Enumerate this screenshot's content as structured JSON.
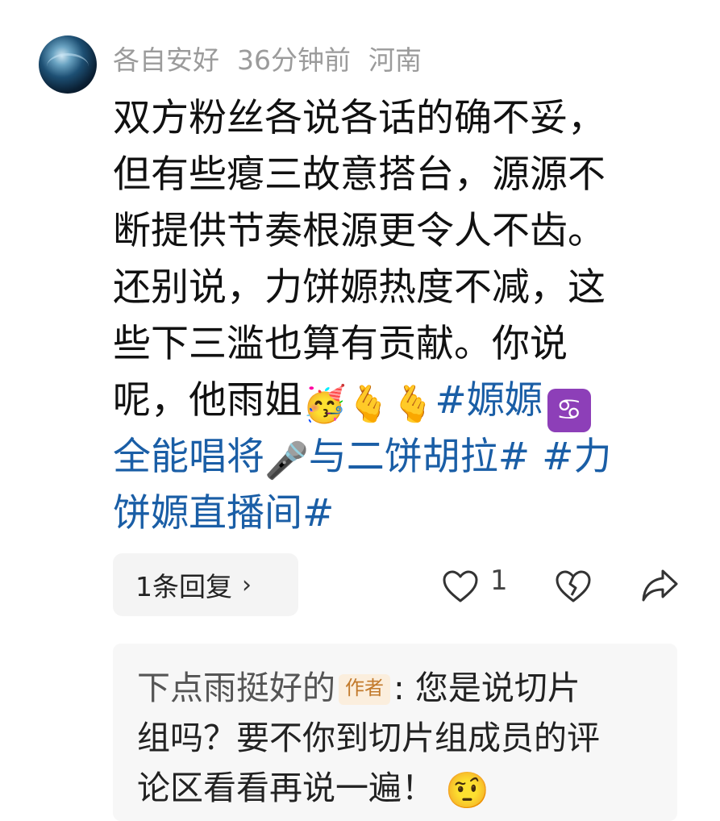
{
  "comment": {
    "username": "各自安好",
    "time": "36分钟前",
    "location": "河南",
    "body_lines": [
      "双方粉丝各说各话的确不妥，",
      "但有些瘪三故意搭台，源源不",
      "断提供节奏根源更令人不齿。",
      "还别说，力饼嫄热度不减，这",
      "些下三滥也算有贡献。你说"
    ],
    "line6_text": "呢，他雨姐",
    "line6_tag": "#嫄嫄",
    "line7_tag_a": "全能唱将",
    "line7_tag_b": "与二饼胡拉#",
    "line7_tag_c": "#力",
    "line8_tag": "饼嫄直播间#",
    "emojis": {
      "singing": "🥳",
      "heart_hand": "🫰",
      "cancer_sign": "♋",
      "microphone": "🎤"
    }
  },
  "actions": {
    "replies_label": "1条回复",
    "replies_chevron": "›",
    "like_count": "1"
  },
  "subreply": {
    "username": "下点雨挺好的",
    "author_badge": "作者",
    "line1_rest": ": 您是说切片",
    "line2": "组吗？要不你到切片组成员的评",
    "line3": "论区看看再说一遍！",
    "emoji": "🤨"
  }
}
